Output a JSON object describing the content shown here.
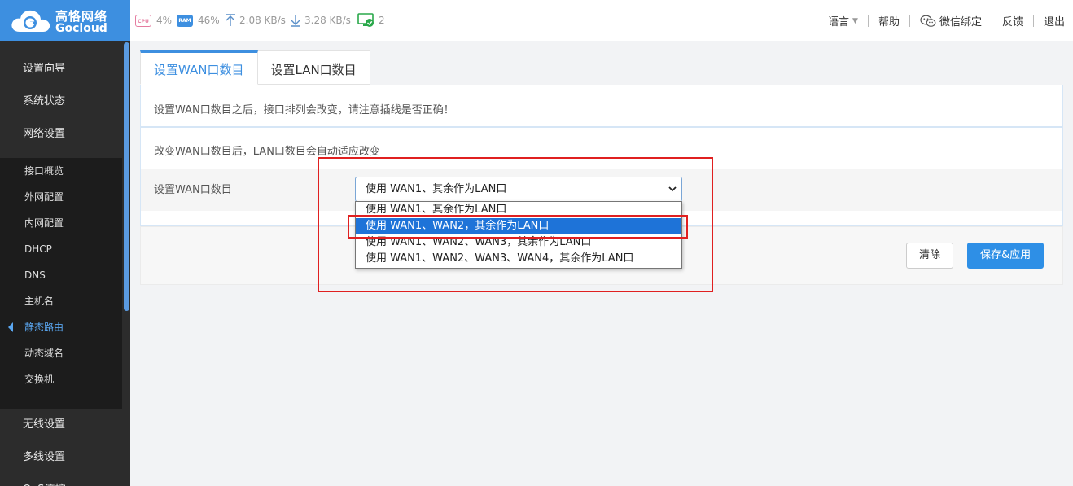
{
  "brand": {
    "name_cn": "高恪网络",
    "name_en": "Gocloud",
    "color": "#3d8fe0"
  },
  "stats": {
    "cpu_chip": "CPU",
    "cpu": "4%",
    "ram_chip": "RAM",
    "ram": "46%",
    "upload": "2.08 KB/s",
    "download": "3.28 KB/s",
    "devices": "2"
  },
  "topnav": {
    "language": "语言",
    "help": "帮助",
    "wechat": "微信绑定",
    "feedback": "反馈",
    "logout": "退出"
  },
  "sidebar": {
    "groups_top": [
      "设置向导",
      "系统状态",
      "网络设置"
    ],
    "sub_items": [
      "接口概览",
      "外网配置",
      "内网配置",
      "DHCP",
      "DNS",
      "主机名",
      "静态路由",
      "动态域名",
      "交换机"
    ],
    "active_sub": "静态路由",
    "groups_bottom": [
      "无线设置",
      "多线设置",
      "QoS流控"
    ]
  },
  "tabs": [
    {
      "label": "设置WAN口数目",
      "active": true
    },
    {
      "label": "设置LAN口数目",
      "active": false
    }
  ],
  "notice": "设置WAN口数目之后，接口排列会改变，请注意插线是否正确！",
  "form": {
    "hint": "改变WAN口数目后，LAN口数目会自动适应改变",
    "label": "设置WAN口数目",
    "selected_value": "使用 WAN1、其余作为LAN口",
    "options": [
      "使用 WAN1、其余作为LAN口",
      "使用 WAN1、WAN2，其余作为LAN口",
      "使用 WAN1、WAN2、WAN3，其余作为LAN口",
      "使用 WAN1、WAN2、WAN3、WAN4，其余作为LAN口"
    ],
    "highlighted_option_index": 1
  },
  "buttons": {
    "clear": "清除",
    "save": "保存&应用"
  },
  "colors": {
    "accent": "#3d8fe0",
    "highlight": "#1e73d8",
    "annotation": "#e02020",
    "sidebar_bg": "#2c2c2c"
  }
}
